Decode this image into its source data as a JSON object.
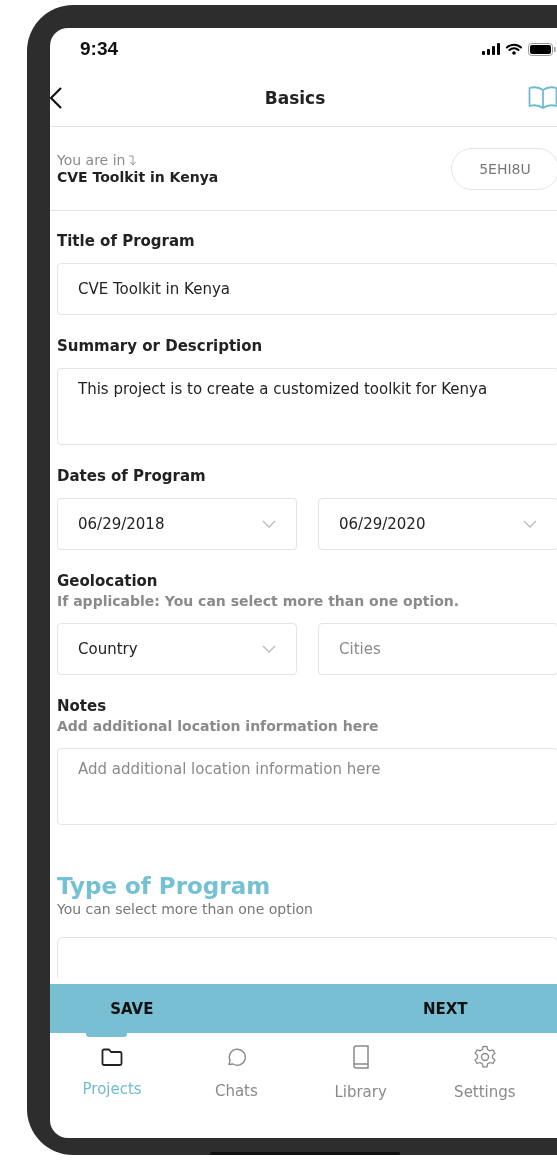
{
  "status_bar": {
    "time": "9:34"
  },
  "header": {
    "title": "Basics"
  },
  "context": {
    "label": "You are in",
    "project": "CVE Toolkit in Kenya",
    "code": "5EHI8U"
  },
  "sections": [
    {
      "label": "Title of Program",
      "inputs": [
        {
          "kind": "text",
          "value": "CVE Toolkit in Kenya"
        }
      ]
    },
    {
      "label": "Summary or Description",
      "inputs": [
        {
          "kind": "textarea",
          "value": "This project is to create a customized toolkit for Kenya"
        }
      ]
    },
    {
      "label": "Dates of Program",
      "inputs": [
        {
          "kind": "select",
          "value": "06/29/2018"
        },
        {
          "kind": "select",
          "value": "06/29/2020"
        }
      ]
    },
    {
      "label": "Geolocation",
      "hint": "If applicable: You can select more than one option.",
      "inputs": [
        {
          "kind": "select",
          "value": "Country"
        },
        {
          "kind": "text",
          "placeholder": "Cities"
        }
      ]
    },
    {
      "label": "Notes",
      "hint": "Add additional location information here",
      "inputs": [
        {
          "kind": "textarea",
          "placeholder": "Add additional location information here"
        }
      ]
    }
  ],
  "type_of_program": {
    "title": "Type of Program",
    "subtitle": "You can select more than one option"
  },
  "actions": [
    "SAVE",
    "NEXT"
  ],
  "tabs": [
    {
      "label": "Projects",
      "selected": true
    },
    {
      "label": "Chats",
      "selected": false
    },
    {
      "label": "Library",
      "selected": false
    },
    {
      "label": "Settings",
      "selected": false
    }
  ]
}
